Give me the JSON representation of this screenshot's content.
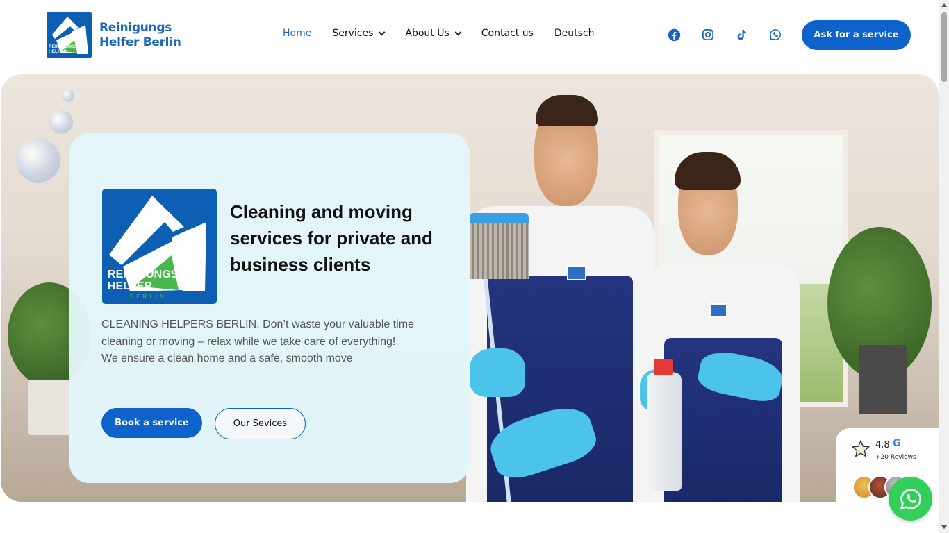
{
  "brand": {
    "name_line1": "Reinigungs",
    "name_line2": "Helfer Berlin",
    "logo_text_line1": "REINIGUNGS",
    "logo_text_line2": "HELFER",
    "logo_text_line3": "BERLIN"
  },
  "nav": {
    "items": [
      {
        "label": "Home",
        "active": true,
        "dropdown": false
      },
      {
        "label": "Services",
        "active": false,
        "dropdown": true
      },
      {
        "label": "About Us",
        "active": false,
        "dropdown": true
      },
      {
        "label": "Contact us",
        "active": false,
        "dropdown": false
      },
      {
        "label": "Deutsch",
        "active": false,
        "dropdown": false
      }
    ]
  },
  "socials": [
    "facebook-icon",
    "instagram-icon",
    "tiktok-icon",
    "whatsapp-icon"
  ],
  "header_cta": "Ask for a service",
  "hero": {
    "title": "Cleaning and moving services for private and business clients",
    "description_line1": "CLEANING HELPERS BERLIN, Don’t waste your valuable time cleaning or moving – relax while we take care of everything!",
    "description_line2": "We ensure a clean home and a safe, smooth move",
    "primary_button": "Book a service",
    "secondary_button": "Our Sevices"
  },
  "reviews": {
    "rating": "4.8",
    "count": "+20 Reviews",
    "provider_icon": "google-icon"
  },
  "colors": {
    "brand_blue": "#0d62cc",
    "card_bg": "#e2f6fa",
    "whatsapp_green": "#33cf5b"
  }
}
